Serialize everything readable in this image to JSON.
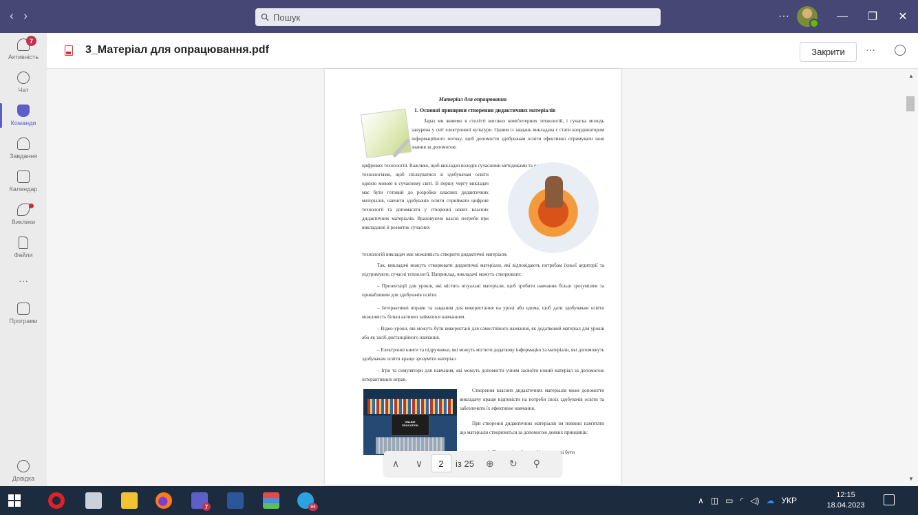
{
  "titlebar": {
    "search_placeholder": "Пошук",
    "more": "···"
  },
  "rail": {
    "items": [
      {
        "label": "Активність",
        "badge": "7"
      },
      {
        "label": "Чат"
      },
      {
        "label": "Команди"
      },
      {
        "label": "Завдання"
      },
      {
        "label": "Календар"
      },
      {
        "label": "Виклики"
      },
      {
        "label": "Файли"
      },
      {
        "label": "···"
      },
      {
        "label": "Програми"
      },
      {
        "label": "Довідка"
      }
    ]
  },
  "document": {
    "title": "3_Матеріал для опрацювання.pdf",
    "close_label": "Закрити",
    "more": "···"
  },
  "page": {
    "heading": "Матеріал для опрацювання",
    "section": "1.        Основні принципи створення дидактичних матеріалів",
    "p1a": "Зараз ми живемо в столітті високих комп'ютерних технологій, і сучасна молодь занурена у світ електронної культури. Одним із завдань викладача є стати координатором інформаційного потоку, щоб допомогти здобувачам освіти ефективно отримувати нові знання за допомогою",
    "p1b": "цифрових технологій. Важливо, щоб викладач володів сучасними методиками та освітніми",
    "p1c": "технологіями, щоб спілкуватися зі здобувачам освіти однією мовою в сучасному світі. В першу чергу викладач має бути готовий до розробки власних дидактичних матеріалів, навчити здобувачів освіти сприймати цифрові технології та допомагати у створенні нових власних дидактичних матеріалів. Враховуючи власні потреби при викладанні й розвиток сучасних",
    "p1d": "технологій викладач має можливість створити дидактичні матеріали.",
    "p2": "Так, викладачі можуть створювати дидактичні матеріали, які відповідають потребам їхньої аудиторії та підтримують сучасні технології. Наприклад, викладачі можуть створювати:",
    "li1": "–   Презентації для уроків, які містять візуальні матеріали, щоб зробити навчання більш зрозумілим та привабливим для здобувачів освіти.",
    "li2": "–   Інтерактивні вправи та завдання для використання на уроці або вдома, щоб дати здобувачам освіти можливість більш активно займатися навчанням.",
    "li3": "–   Відео-уроки, які можуть бути використані для самостійного навчання, як додатковий матеріал для уроків або як засіб дистанційного навчання.",
    "li4": "–   Електронні книги та підручники, які можуть містити додаткову інформацію та матеріали, які допоможуть здобувачам освіти краще зрозуміти матеріал.",
    "li5": "–   Ігри та симулятори для навчання, які можуть допомогти учням засвоїти новий матеріал за допомогою інтерактивних вправ.",
    "p3": "Створення власних дидактичних матеріалів може допомогти викладачу краще відповісти на потреби своїх здобувачів освіти та забезпечити їх ефективне навчання.",
    "p4": "При створенні дидактичних матеріалів зм повинні пам'ятати що матеріали створюються за допомогою деяких принципів:",
    "p5": "1.   Психологічної специфіки повинні бути",
    "img3_text1": "ONLINE",
    "img3_text2": "EDUCATION"
  },
  "pdf_toolbar": {
    "page": "2",
    "of_label": "із 25"
  },
  "taskbar": {
    "lang": "УКР",
    "time": "12:15",
    "date": "18.04.2023",
    "teams_badge": "7",
    "telegram_badge": "94"
  }
}
